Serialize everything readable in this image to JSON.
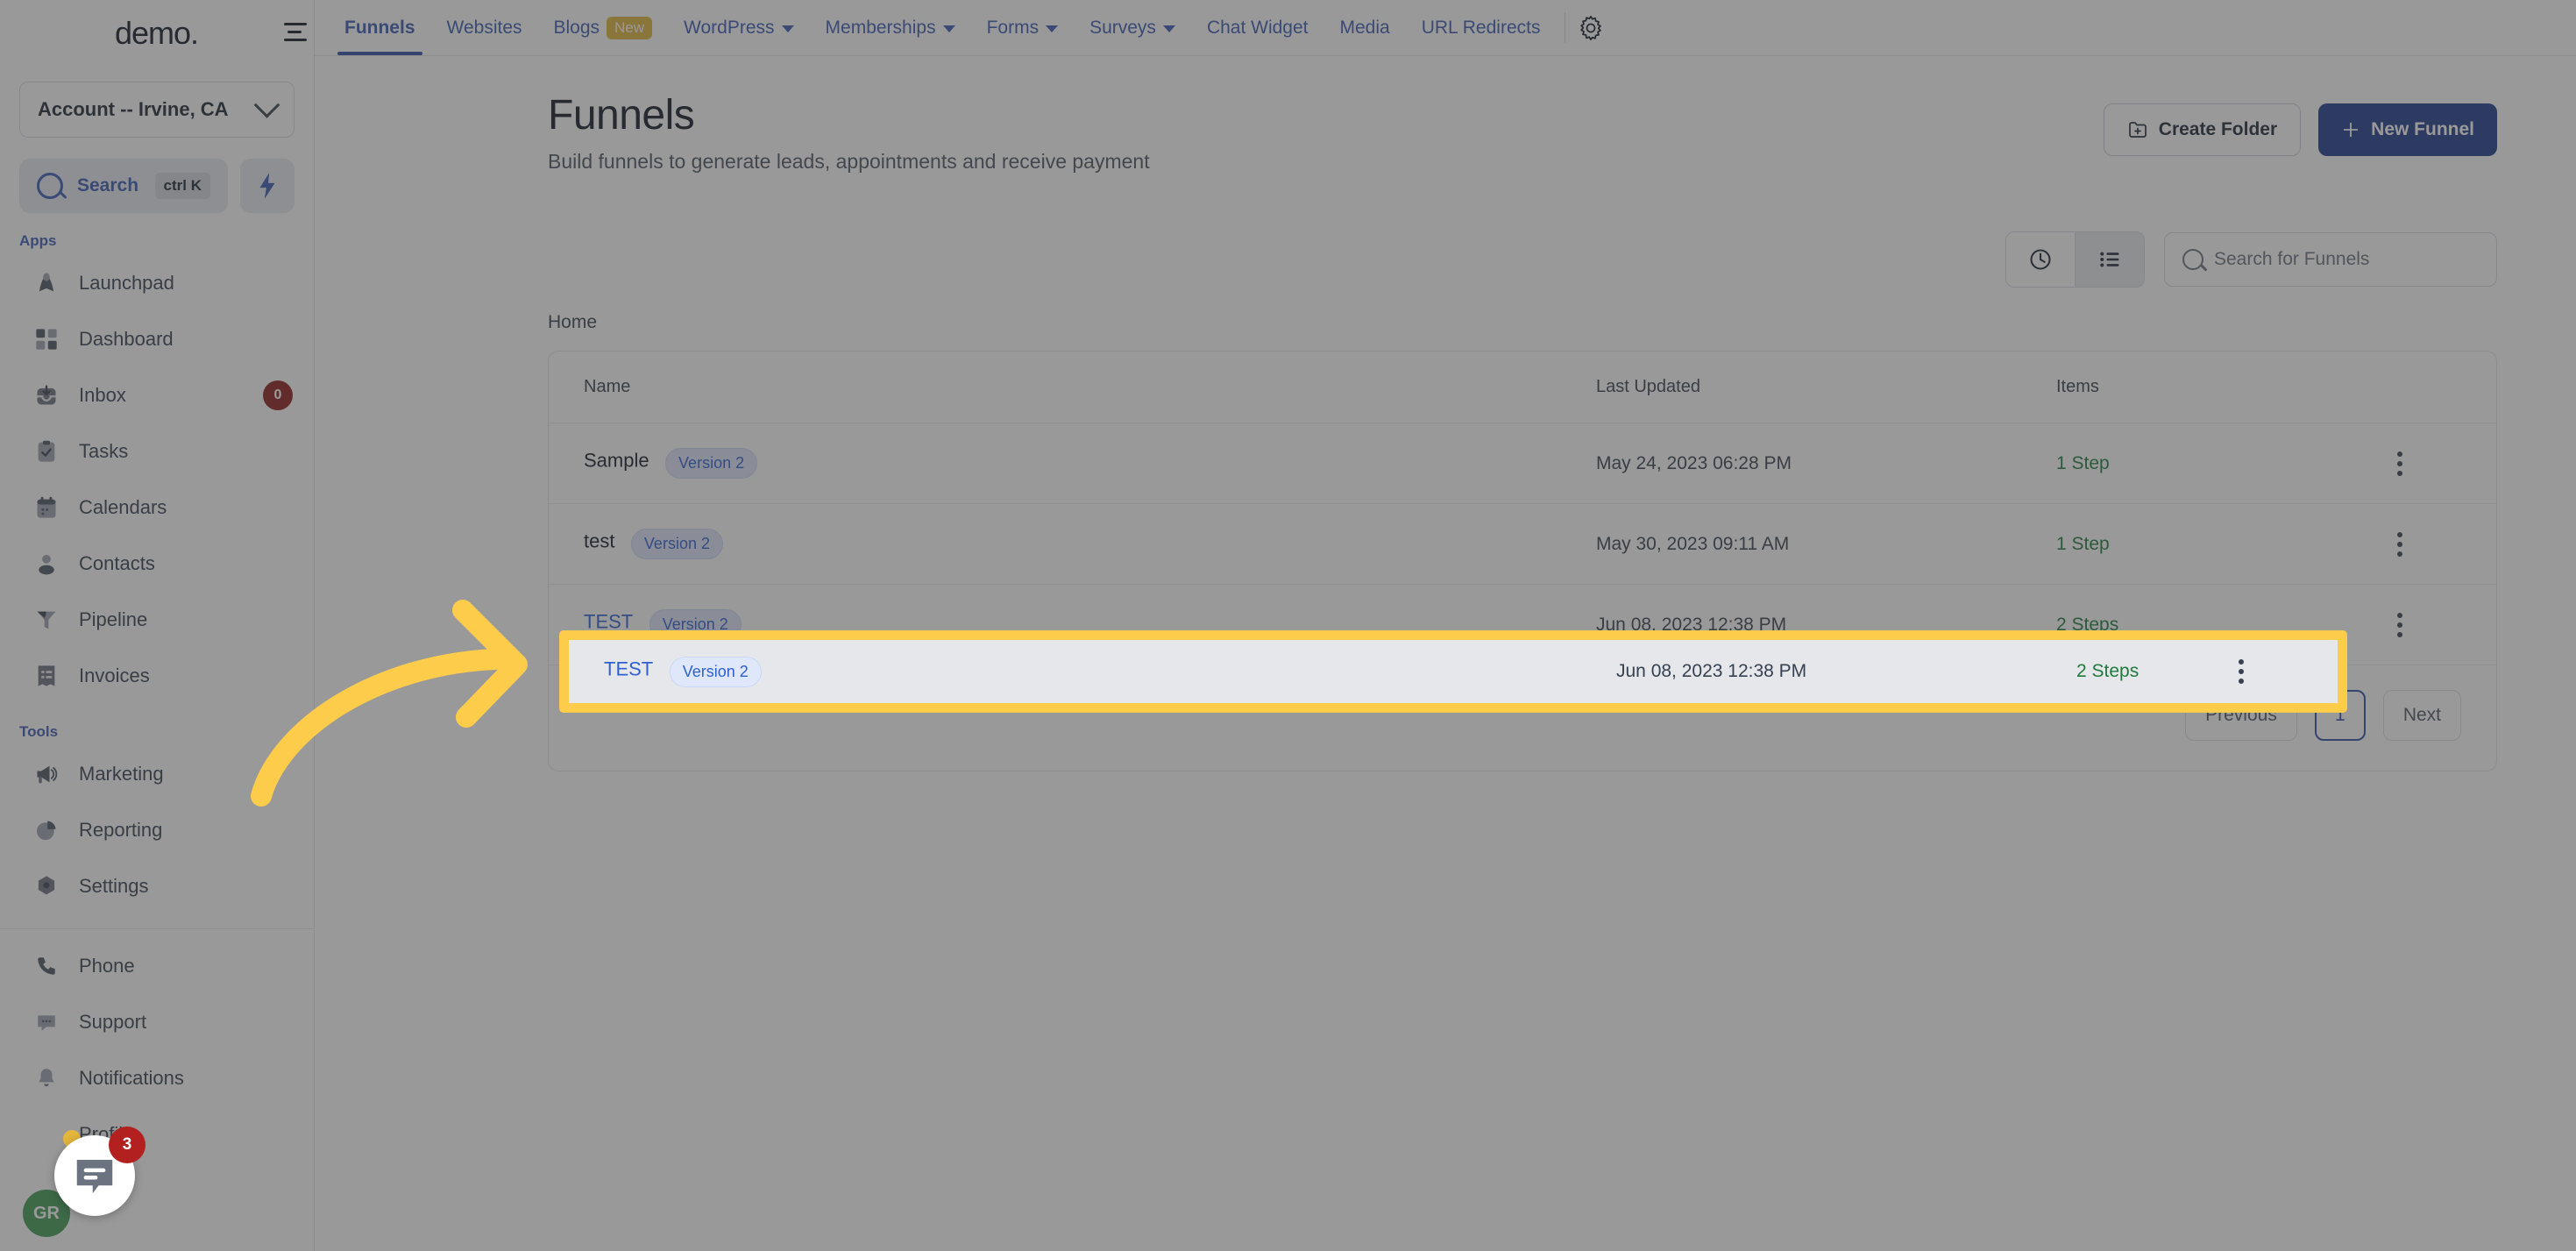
{
  "sidebar": {
    "brand": "demo",
    "account_selector": {
      "label": "Account -- Irvine, CA",
      "icon": "chevron-down-icon"
    },
    "search": {
      "label": "Search",
      "shortcut": "ctrl K",
      "icon": "search-icon"
    },
    "quick_action_icon": "lightning-bolt-icon",
    "sections": [
      {
        "title": "Apps",
        "items": [
          {
            "label": "Launchpad",
            "icon": "rocket-icon",
            "badge": ""
          },
          {
            "label": "Dashboard",
            "icon": "grid-icon",
            "badge": ""
          },
          {
            "label": "Inbox",
            "icon": "inbox-icon",
            "badge": "0"
          },
          {
            "label": "Tasks",
            "icon": "clipboard-check-icon",
            "badge": ""
          },
          {
            "label": "Calendars",
            "icon": "calendar-icon",
            "badge": ""
          },
          {
            "label": "Contacts",
            "icon": "user-icon",
            "badge": ""
          },
          {
            "label": "Pipeline",
            "icon": "funnel-icon",
            "badge": ""
          },
          {
            "label": "Invoices",
            "icon": "invoice-icon",
            "badge": ""
          }
        ]
      },
      {
        "title": "Tools",
        "items": [
          {
            "label": "Marketing",
            "icon": "megaphone-icon",
            "badge": ""
          },
          {
            "label": "Reporting",
            "icon": "pie-chart-icon",
            "badge": ""
          },
          {
            "label": "Settings",
            "icon": "gear-icon",
            "badge": ""
          }
        ]
      }
    ],
    "footer_items": [
      {
        "label": "Phone",
        "icon": "phone-icon",
        "badge": ""
      },
      {
        "label": "Support",
        "icon": "chat-icon",
        "badge": ""
      },
      {
        "label": "Notifications",
        "icon": "bell-icon",
        "badge": ""
      },
      {
        "label": "Profile",
        "icon": "avatar-icon",
        "badge": ""
      }
    ],
    "avatar_initials": "GR"
  },
  "topbar": {
    "collapse_icon": "menu-collapse-icon",
    "tabs": [
      {
        "label": "Funnels",
        "active": true,
        "caret": false,
        "pill": ""
      },
      {
        "label": "Websites",
        "active": false,
        "caret": false,
        "pill": ""
      },
      {
        "label": "Blogs",
        "active": false,
        "caret": false,
        "pill": "New"
      },
      {
        "label": "WordPress",
        "active": false,
        "caret": true,
        "pill": ""
      },
      {
        "label": "Memberships",
        "active": false,
        "caret": true,
        "pill": ""
      },
      {
        "label": "Forms",
        "active": false,
        "caret": true,
        "pill": ""
      },
      {
        "label": "Surveys",
        "active": false,
        "caret": true,
        "pill": ""
      },
      {
        "label": "Chat Widget",
        "active": false,
        "caret": false,
        "pill": ""
      },
      {
        "label": "Media",
        "active": false,
        "caret": false,
        "pill": ""
      },
      {
        "label": "URL Redirects",
        "active": false,
        "caret": false,
        "pill": ""
      }
    ],
    "settings_icon": "gear-icon"
  },
  "main": {
    "title": "Funnels",
    "subtitle": "Build funnels to generate leads, appointments and receive payment",
    "create_folder_label": "Create Folder",
    "new_funnel_label": "+ New Funnel",
    "new_funnel_text": "New Funnel",
    "view_recent_icon": "clock-icon",
    "view_list_icon": "list-icon",
    "search_placeholder": "Search for Funnels",
    "breadcrumb": "Home",
    "columns": {
      "name": "Name",
      "last_updated": "Last Updated",
      "items": "Items"
    },
    "rows": [
      {
        "name": "Sample",
        "version": "Version 2",
        "last_updated": "May 24, 2023 06:28 PM",
        "items": "1 Step",
        "highlighted": false
      },
      {
        "name": "test",
        "version": "Version 2",
        "last_updated": "May 30, 2023 09:11 AM",
        "items": "1 Step",
        "highlighted": false
      },
      {
        "name": "TEST",
        "version": "Version 2",
        "last_updated": "Jun 08, 2023 12:38 PM",
        "items": "2 Steps",
        "highlighted": true
      }
    ],
    "pagination": {
      "previous": "Previous",
      "current": "1",
      "next": "Next"
    }
  },
  "annotations": {
    "highlight_color": "#FDCC4A",
    "arrow_color": "#FDCC4A",
    "arrow_target": "TEST row"
  },
  "chat_widget": {
    "badge": "3",
    "icon": "chat-bubble-icon"
  },
  "colors": {
    "primary": "#1e3a8a",
    "link": "#3b5bb5",
    "success": "#1f7a3d",
    "danger": "#8f1d1d",
    "highlight": "#FDCC4A"
  }
}
